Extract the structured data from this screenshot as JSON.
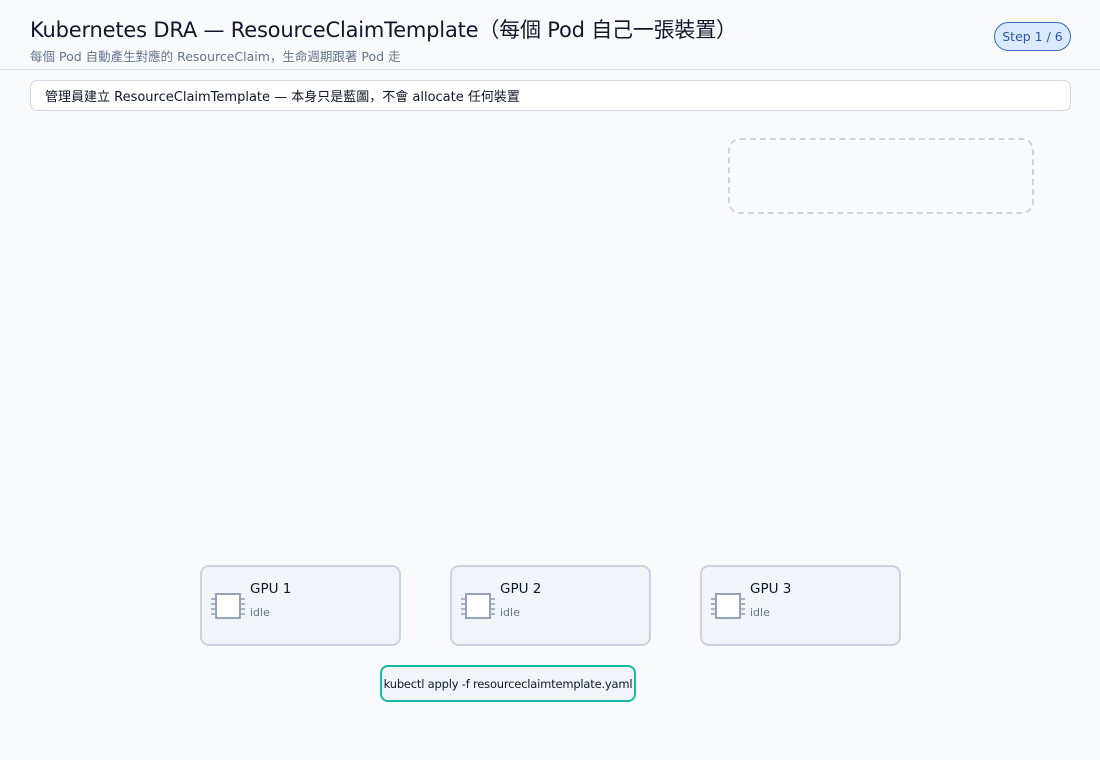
{
  "header": {
    "title": "Kubernetes DRA — ResourceClaimTemplate（每個 Pod 自己一張裝置）",
    "subtitle": "每個 Pod 自動產生對應的 ResourceClaim，生命週期跟著 Pod 走",
    "step": "Step 1 / 6"
  },
  "message": "管理員建立 ResourceClaimTemplate — 本身只是藍圖，不會 allocate 任何裝置",
  "gpus": [
    {
      "name": "GPU 1",
      "status": "idle"
    },
    {
      "name": "GPU 2",
      "status": "idle"
    },
    {
      "name": "GPU 3",
      "status": "idle"
    }
  ],
  "command": "kubectl apply -f resourceclaimtemplate.yaml",
  "colors": {
    "accent": "#14b8a6",
    "step_badge": "#3b6cc4",
    "card_border": "#cbd3df"
  },
  "icons": {
    "gpu": "chip-icon"
  }
}
